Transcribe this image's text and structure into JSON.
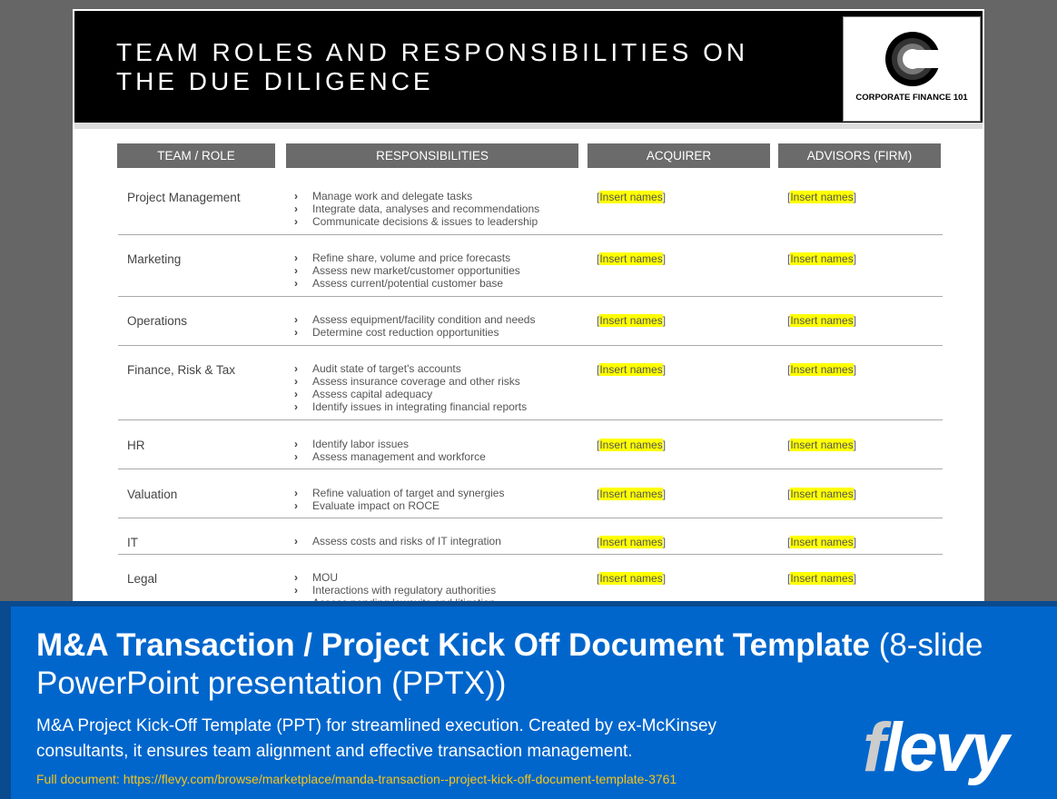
{
  "slide": {
    "title": "TEAM ROLES AND RESPONSIBILITIES ON THE DUE DILIGENCE",
    "logo_text": "CORPORATE FINANCE 101"
  },
  "table": {
    "headers": [
      "TEAM / ROLE",
      "RESPONSIBILITIES",
      "ACQUIRER",
      "ADVISORS (FIRM)"
    ],
    "rows": [
      {
        "role": "Project Management",
        "items": [
          "Manage work and delegate tasks",
          "Integrate data, analyses and recommendations",
          "Communicate decisions & issues to leadership"
        ],
        "acquirer": "Insert names",
        "advisors": "Insert names"
      },
      {
        "role": "Marketing",
        "items": [
          "Refine share, volume and price forecasts",
          "Assess new market/customer opportunities",
          "Assess current/potential customer base"
        ],
        "acquirer": "Insert names",
        "advisors": "Insert names"
      },
      {
        "role": "Operations",
        "items": [
          "Assess equipment/facility condition and needs",
          "Determine cost reduction opportunities"
        ],
        "acquirer": "Insert names",
        "advisors": "Insert names"
      },
      {
        "role": "Finance, Risk & Tax",
        "items": [
          "Audit state of target's accounts",
          "Assess insurance coverage and other risks",
          "Assess capital adequacy",
          "Identify issues in integrating financial reports"
        ],
        "acquirer": "Insert names",
        "advisors": "Insert names"
      },
      {
        "role": "HR",
        "items": [
          "Identify labor issues",
          "Assess management and workforce"
        ],
        "acquirer": "Insert names",
        "advisors": "Insert names"
      },
      {
        "role": "Valuation",
        "items": [
          "Refine valuation of target and synergies",
          "Evaluate impact on ROCE"
        ],
        "acquirer": "Insert names",
        "advisors": "Insert names"
      },
      {
        "role": "IT",
        "items": [
          "Assess costs and risks of IT integration"
        ],
        "acquirer": "Insert names",
        "advisors": "Insert names"
      },
      {
        "role": "Legal",
        "items": [
          "MOU",
          "Interactions with regulatory authorities",
          "Assess pending lawsuits and litigation"
        ],
        "acquirer": "Insert names",
        "advisors": "Insert names"
      }
    ]
  },
  "banner": {
    "title": "M&A Transaction / Project Kick Off Document Template",
    "title_suffix": "(8-slide PowerPoint presentation (PPTX))",
    "description": "M&A Project Kick-Off Template (PPT) for streamlined execution. Created by ex-McKinsey consultants, it ensures team alignment and effective transaction management.",
    "link": "Full document: https://flevy.com/browse/marketplace/manda-transaction--project-kick-off-document-template-3761",
    "brand": "flevy"
  },
  "colors": {
    "header_bg": "#000000",
    "th_bg": "#6b6b6b",
    "highlight": "#ffff00",
    "banner_bg": "#0066cc",
    "link": "#f5c518"
  }
}
